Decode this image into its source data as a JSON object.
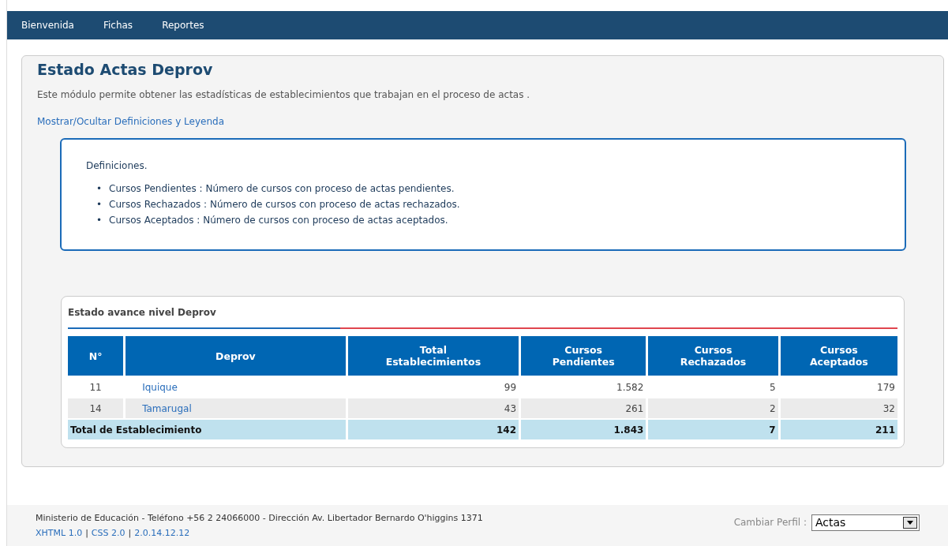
{
  "nav": [
    {
      "label": "Bienvenida"
    },
    {
      "label": "Fichas"
    },
    {
      "label": "Reportes"
    }
  ],
  "page": {
    "title": "Estado Actas Deprov",
    "description": "Este módulo permite obtener las estadísticas de establecimientos que trabajan en el proceso de actas .",
    "toggle_link": "Mostrar/Ocultar Definiciones y Leyenda"
  },
  "definitions": {
    "heading": "Definiciones.",
    "bullet": "•",
    "items": [
      "Cursos Pendientes : Número de cursos con proceso de actas pendientes.",
      "Cursos Rechazados : Número de cursos con proceso de actas rechazados.",
      "Cursos Aceptados : Número de cursos con proceso de actas aceptados."
    ]
  },
  "table": {
    "title": "Estado avance nivel Deprov",
    "columns": [
      {
        "label": "N°"
      },
      {
        "label": "Deprov"
      },
      {
        "label": "Total Establecimientos"
      },
      {
        "label": "Cursos Pendientes"
      },
      {
        "label": "Cursos Rechazados"
      },
      {
        "label": "Cursos Aceptados"
      }
    ],
    "rows": [
      {
        "number": "11",
        "deprov": "Iquique",
        "total": "99",
        "pendientes": "1.582",
        "rechazados": "5",
        "aceptados": "179"
      },
      {
        "number": "14",
        "deprov": "Tamarugal",
        "total": "43",
        "pendientes": "261",
        "rechazados": "2",
        "aceptados": "32"
      }
    ],
    "total_row": {
      "label": "Total de Establecimiento",
      "total": "142",
      "pendientes": "1.843",
      "rechazados": "7",
      "aceptados": "211"
    }
  },
  "footer": {
    "contact": "Ministerio de Educación - Teléfono +56 2 24066000 - Dirección Av. Libertador Bernardo O'higgins 1371",
    "links": [
      "XHTML 1.0",
      "CSS 2.0",
      "2.0.14.12.12"
    ],
    "separator": "|",
    "profile_label": "Cambiar Perfil :",
    "profile_value": "Actas"
  }
}
